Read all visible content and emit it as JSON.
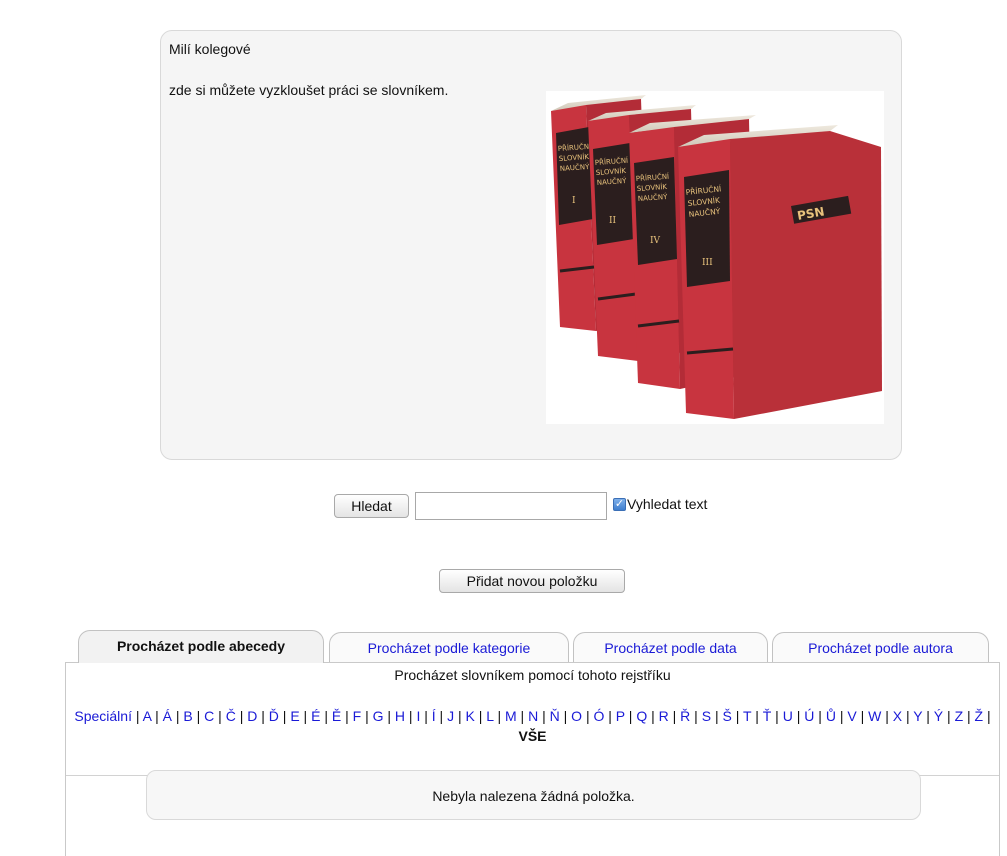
{
  "intro": {
    "greeting": "Milí kolegové",
    "text": "zde si můžete vyzkloušet práci se slovníkem."
  },
  "books": {
    "spine_title": [
      "PŘÍRUČNÍ",
      "SLOVNÍK",
      "NAUČNÝ"
    ],
    "volumes": [
      "I",
      "II",
      "IV",
      "III"
    ],
    "cover_logo": "PSN",
    "color": "#c8343f"
  },
  "search": {
    "button_label": "Hledat",
    "input_value": "",
    "checkbox_checked": true,
    "checkbox_label": "Vyhledat text"
  },
  "add_entry": {
    "label": "Přidat novou položku"
  },
  "tabs": [
    {
      "label": "Procházet podle abecedy",
      "active": true
    },
    {
      "label": "Procházet podle kategorie",
      "active": false
    },
    {
      "label": "Procházet podle data",
      "active": false
    },
    {
      "label": "Procházet podle autora",
      "active": false
    }
  ],
  "browse": {
    "header": "Procházet slovníkem pomocí tohoto rejstříku",
    "letters": [
      "Speciální",
      "A",
      "Á",
      "B",
      "C",
      "Č",
      "D",
      "Ď",
      "E",
      "É",
      "Ě",
      "F",
      "G",
      "H",
      "I",
      "Í",
      "J",
      "K",
      "L",
      "M",
      "N",
      "Ň",
      "O",
      "Ó",
      "P",
      "Q",
      "R",
      "Ř",
      "S",
      "Š",
      "T",
      "Ť",
      "U",
      "Ú",
      "Ů",
      "V",
      "W",
      "X",
      "Y",
      "Ý",
      "Z",
      "Ž"
    ],
    "all_label": "VŠE"
  },
  "empty_message": "Nebyla nalezena žádná položka.",
  "colors": {
    "link": "#1a1ad6",
    "panel_border": "#c9c9c9"
  }
}
